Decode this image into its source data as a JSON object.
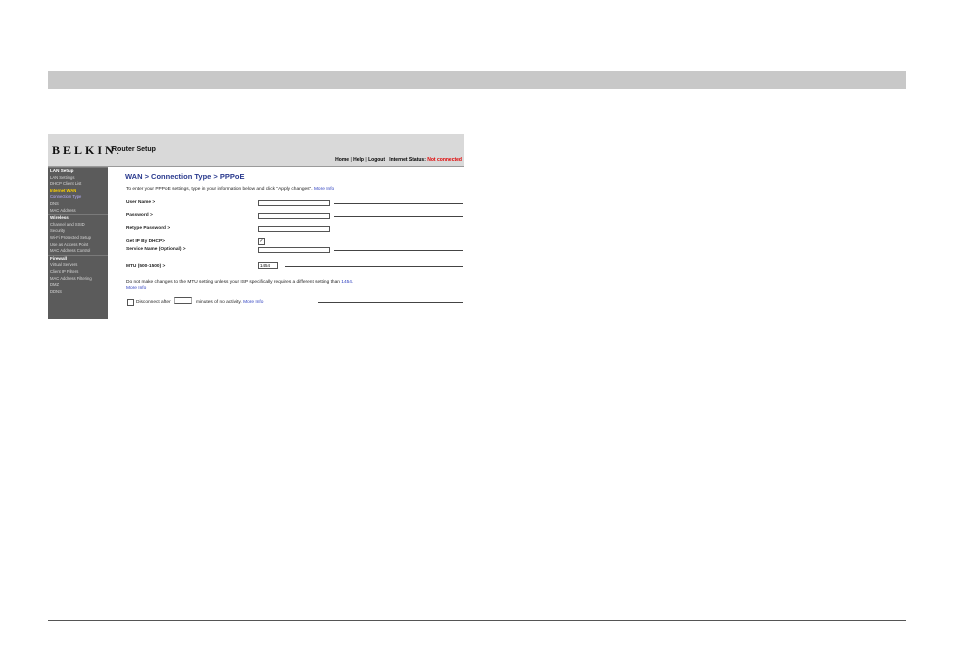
{
  "header": {
    "logo": "BELKIN",
    "logo_dot": ".",
    "title": "Router Setup",
    "links": {
      "home": "Home",
      "help": "Help",
      "logout": "Logout",
      "sep": "|",
      "status_label": "Internet Status:",
      "status_value": "Not connected"
    }
  },
  "sidebar": {
    "items": [
      {
        "label": "LAN Setup"
      },
      {
        "label": "LAN Settings"
      },
      {
        "label": "DHCP Client List"
      },
      {
        "label": "Internet WAN"
      },
      {
        "label": "Connection Type"
      },
      {
        "label": "DNS"
      },
      {
        "label": "MAC Address"
      },
      {
        "label": "Wireless"
      },
      {
        "label": "Channel and SSID"
      },
      {
        "label": "Security"
      },
      {
        "label": "Wi-Fi Protected Setup"
      },
      {
        "label": "Use as Access Point"
      },
      {
        "label": "MAC Address Control"
      },
      {
        "label": "Firewall"
      },
      {
        "label": "Virtual Servers"
      },
      {
        "label": "Client IP Filters"
      },
      {
        "label": "MAC Address Filtering"
      },
      {
        "label": "DMZ"
      },
      {
        "label": "DDNS"
      }
    ]
  },
  "main": {
    "breadcrumb": "WAN > Connection Type > PPPoE",
    "intro": "To enter your PPPoE settings, type in your information below and click \"Apply changes\".",
    "more_info": "More Info",
    "fields": {
      "user_name": "User Name >",
      "password": "Password >",
      "retype_password": "Retype Password >",
      "get_ip_dhcp": "Get IP By DHCP>",
      "service_name": "Service Name (Optional) >",
      "mtu": "MTU (500-1500) >"
    },
    "get_ip_checked": "✓",
    "mtu_value": "1454",
    "note": "Do not make changes to the MTU setting unless your ISP specifically requires a different setting than",
    "note_value": "1454.",
    "disconnect_label": "Disconnect after",
    "disconnect_tail": "minutes of no activity.",
    "disconnect_checkbox": ""
  }
}
